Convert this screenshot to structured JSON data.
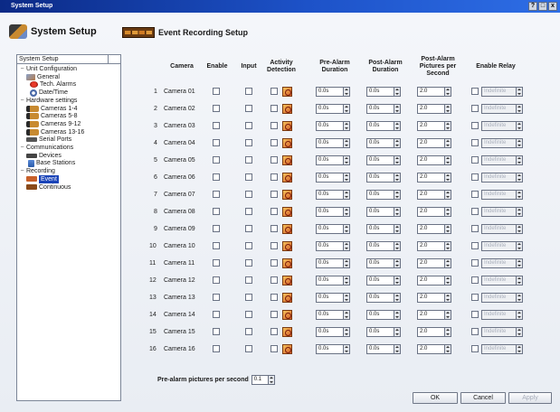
{
  "window": {
    "title": "System Setup"
  },
  "header": {
    "left_title": "System Setup",
    "section_title": "Event Recording Setup"
  },
  "tree": {
    "root": "System Setup",
    "items": [
      {
        "label": "Unit Configuration",
        "icon": "folder-icon"
      },
      {
        "label": "General",
        "icon": "general-icon"
      },
      {
        "label": "Tech. Alarms",
        "icon": "alarm-icon"
      },
      {
        "label": "Date/Time",
        "icon": "clock-icon"
      },
      {
        "label": "Hardware settings",
        "icon": "folder-icon"
      },
      {
        "label": "Cameras 1-4",
        "icon": "camera-icon"
      },
      {
        "label": "Cameras 5-8",
        "icon": "camera-icon"
      },
      {
        "label": "Cameras 9-12",
        "icon": "camera-icon"
      },
      {
        "label": "Cameras 13-16",
        "icon": "camera-icon"
      },
      {
        "label": "Serial Ports",
        "icon": "port-icon"
      },
      {
        "label": "Communications",
        "icon": "folder-icon"
      },
      {
        "label": "Devices",
        "icon": "device-icon"
      },
      {
        "label": "Base Stations",
        "icon": "base-station-icon"
      },
      {
        "label": "Recording",
        "icon": "folder-icon"
      },
      {
        "label": "Event",
        "icon": "event-icon"
      },
      {
        "label": "Continuous",
        "icon": "continuous-icon"
      }
    ]
  },
  "table": {
    "headers": {
      "camera": "Camera",
      "enable": "Enable",
      "input": "Input",
      "activity": "Activity Detection",
      "pre": "Pre-Alarm Duration",
      "post": "Post-Alarm Duration",
      "pps": "Post-Alarm Pictures per Second",
      "relay": "Enable Relay"
    },
    "rows": [
      {
        "num": "1",
        "name": "Camera 01",
        "pre": "0.0s",
        "post": "0.0s",
        "pps": "2.0",
        "relay": "Indefinite"
      },
      {
        "num": "2",
        "name": "Camera 02",
        "pre": "0.0s",
        "post": "0.0s",
        "pps": "2.0",
        "relay": "Indefinite"
      },
      {
        "num": "3",
        "name": "Camera 03",
        "pre": "0.0s",
        "post": "0.0s",
        "pps": "2.0",
        "relay": "Indefinite"
      },
      {
        "num": "4",
        "name": "Camera 04",
        "pre": "0.0s",
        "post": "0.0s",
        "pps": "2.0",
        "relay": "Indefinite"
      },
      {
        "num": "5",
        "name": "Camera 05",
        "pre": "0.0s",
        "post": "0.0s",
        "pps": "2.0",
        "relay": "Indefinite"
      },
      {
        "num": "6",
        "name": "Camera 06",
        "pre": "0.0s",
        "post": "0.0s",
        "pps": "2.0",
        "relay": "Indefinite"
      },
      {
        "num": "7",
        "name": "Camera 07",
        "pre": "0.0s",
        "post": "0.0s",
        "pps": "2.0",
        "relay": "Indefinite"
      },
      {
        "num": "8",
        "name": "Camera 08",
        "pre": "0.0s",
        "post": "0.0s",
        "pps": "2.0",
        "relay": "Indefinite"
      },
      {
        "num": "9",
        "name": "Camera 09",
        "pre": "0.0s",
        "post": "0.0s",
        "pps": "2.0",
        "relay": "Indefinite"
      },
      {
        "num": "10",
        "name": "Camera 10",
        "pre": "0.0s",
        "post": "0.0s",
        "pps": "2.0",
        "relay": "Indefinite"
      },
      {
        "num": "11",
        "name": "Camera 11",
        "pre": "0.0s",
        "post": "0.0s",
        "pps": "2.0",
        "relay": "Indefinite"
      },
      {
        "num": "12",
        "name": "Camera 12",
        "pre": "0.0s",
        "post": "0.0s",
        "pps": "2.0",
        "relay": "Indefinite"
      },
      {
        "num": "13",
        "name": "Camera 13",
        "pre": "0.0s",
        "post": "0.0s",
        "pps": "2.0",
        "relay": "Indefinite"
      },
      {
        "num": "14",
        "name": "Camera 14",
        "pre": "0.0s",
        "post": "0.0s",
        "pps": "2.0",
        "relay": "Indefinite"
      },
      {
        "num": "15",
        "name": "Camera 15",
        "pre": "0.0s",
        "post": "0.0s",
        "pps": "2.0",
        "relay": "Indefinite"
      },
      {
        "num": "16",
        "name": "Camera 16",
        "pre": "0.0s",
        "post": "0.0s",
        "pps": "2.0",
        "relay": "Indefinite"
      }
    ]
  },
  "footer": {
    "prealarm_label": "Pre-alarm pictures per second",
    "prealarm_value": "0.1"
  },
  "buttons": {
    "ok": "OK",
    "cancel": "Cancel",
    "apply": "Apply"
  },
  "title_buttons": {
    "help": "?",
    "restore": "□",
    "close": "x"
  }
}
